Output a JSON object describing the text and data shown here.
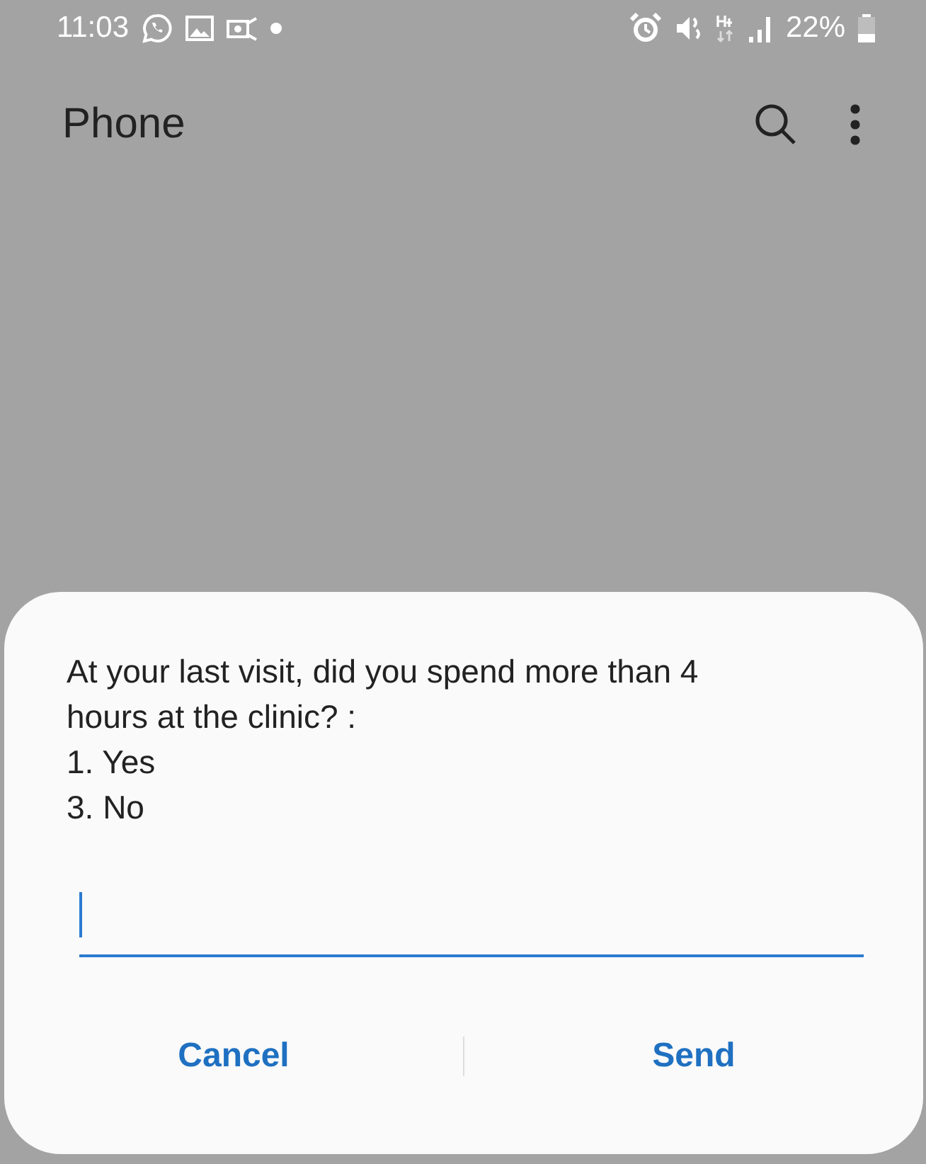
{
  "status_bar": {
    "time": "11:03",
    "battery": "22%"
  },
  "app_bar": {
    "title": "Phone"
  },
  "dialog": {
    "message": "At your last visit, did you spend more than 4\nhours at the clinic? :\n1. Yes\n3. No",
    "input": {
      "focused": true
    },
    "buttons": [
      "Cancel",
      "Send"
    ]
  }
}
